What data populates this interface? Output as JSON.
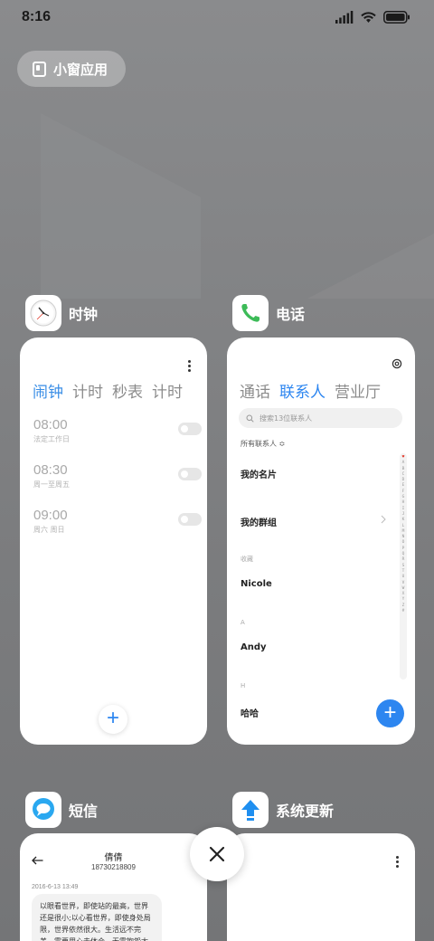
{
  "status_bar": {
    "time": "8:16",
    "icons": [
      "signal-icon",
      "wifi-icon",
      "battery-icon"
    ]
  },
  "floating_window": {
    "label": "小窗应用",
    "icon": "floating-window-icon"
  },
  "apps": [
    {
      "name": "时钟",
      "icon": "clock-icon",
      "tabs": [
        "闹钟",
        "计时",
        "秒表",
        "计时"
      ],
      "active_tab": 0,
      "alarms": [
        {
          "time": "08:00",
          "repeat": "法定工作日",
          "enabled": false
        },
        {
          "time": "08:30",
          "repeat": "周一至周五",
          "enabled": false
        },
        {
          "time": "09:00",
          "repeat": "周六 周日",
          "enabled": false
        }
      ],
      "add_label": "+"
    },
    {
      "name": "电话",
      "icon": "phone-icon",
      "tabs": [
        "通话",
        "联系人",
        "营业厅"
      ],
      "active_tab": 1,
      "search_placeholder": "搜索13位联系人",
      "filter_label": "所有联系人 ≎",
      "items": {
        "my_card": "我的名片",
        "my_groups": "我的群组",
        "favorites_label": "收藏",
        "favorite_contact": "Nicole",
        "section_a": "A",
        "contact_a": "Andy",
        "section_h": "H",
        "contact_h": "哈哈"
      },
      "index_letters": [
        "♥",
        "A",
        "B",
        "C",
        "D",
        "E",
        "F",
        "G",
        "H",
        "I",
        "J",
        "K",
        "L",
        "M",
        "N",
        "O",
        "P",
        "Q",
        "R",
        "S",
        "T",
        "U",
        "V",
        "W",
        "X",
        "Y",
        "Z",
        "#"
      ],
      "add_label": "+"
    },
    {
      "name": "短信",
      "icon": "message-icon",
      "contact_name": "倩倩",
      "contact_number": "18730218809",
      "date": "2016-6-13 13:49",
      "message": "以眼看世界，即使站的最高，世界还是很小;以心看世界，即使身处局限，世界依然很大。生活远不完美，需要用心去体会，无需抱怨太"
    },
    {
      "name": "系统更新",
      "icon": "system-update-icon"
    }
  ],
  "colors": {
    "accent": "#2d86f0",
    "clock_accent": "#3a8ee6",
    "background": "#7f8082"
  }
}
